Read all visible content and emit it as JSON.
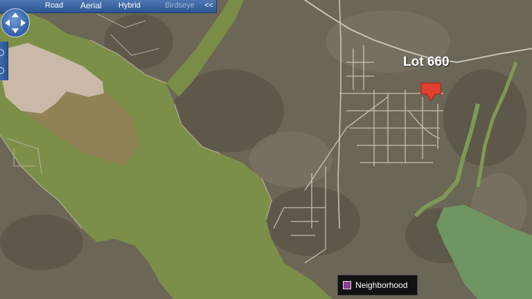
{
  "map_type_bar": {
    "road_label": "Road",
    "aerial_label": "Aerial",
    "hybrid_label": "Hybrid",
    "birdseye_label": "Birdseye",
    "collapse_label": "<<",
    "active": "Aerial"
  },
  "controls": {
    "pan_icon": "pan-arrows-icon",
    "zoom_in_icon": "zoom-in-icon",
    "zoom_out_icon": "zoom-out-icon"
  },
  "marker": {
    "label": "Lot 660",
    "icon": "map-pin-icon",
    "color": "#e1402f"
  },
  "legend": {
    "label": "Neighborhood",
    "swatch_color": "#8e3a93"
  },
  "colors": {
    "water": "#7c8f48",
    "land": "#6c6656",
    "sandbar": "#c9b9a6",
    "roads": "#c8c3b8",
    "control_blue": "#2c5591"
  }
}
